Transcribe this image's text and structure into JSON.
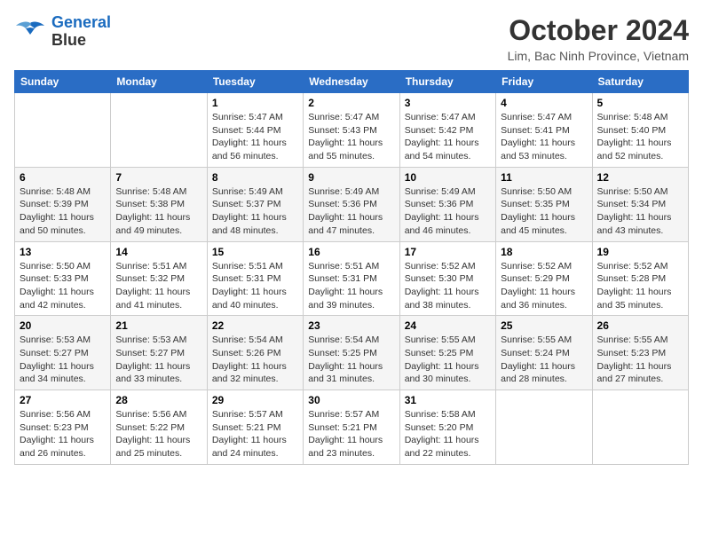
{
  "logo": {
    "line1": "General",
    "line2": "Blue"
  },
  "title": "October 2024",
  "location": "Lim, Bac Ninh Province, Vietnam",
  "weekdays": [
    "Sunday",
    "Monday",
    "Tuesday",
    "Wednesday",
    "Thursday",
    "Friday",
    "Saturday"
  ],
  "weeks": [
    [
      {
        "day": "",
        "info": ""
      },
      {
        "day": "",
        "info": ""
      },
      {
        "day": "1",
        "info": "Sunrise: 5:47 AM\nSunset: 5:44 PM\nDaylight: 11 hours and 56 minutes."
      },
      {
        "day": "2",
        "info": "Sunrise: 5:47 AM\nSunset: 5:43 PM\nDaylight: 11 hours and 55 minutes."
      },
      {
        "day": "3",
        "info": "Sunrise: 5:47 AM\nSunset: 5:42 PM\nDaylight: 11 hours and 54 minutes."
      },
      {
        "day": "4",
        "info": "Sunrise: 5:47 AM\nSunset: 5:41 PM\nDaylight: 11 hours and 53 minutes."
      },
      {
        "day": "5",
        "info": "Sunrise: 5:48 AM\nSunset: 5:40 PM\nDaylight: 11 hours and 52 minutes."
      }
    ],
    [
      {
        "day": "6",
        "info": "Sunrise: 5:48 AM\nSunset: 5:39 PM\nDaylight: 11 hours and 50 minutes."
      },
      {
        "day": "7",
        "info": "Sunrise: 5:48 AM\nSunset: 5:38 PM\nDaylight: 11 hours and 49 minutes."
      },
      {
        "day": "8",
        "info": "Sunrise: 5:49 AM\nSunset: 5:37 PM\nDaylight: 11 hours and 48 minutes."
      },
      {
        "day": "9",
        "info": "Sunrise: 5:49 AM\nSunset: 5:36 PM\nDaylight: 11 hours and 47 minutes."
      },
      {
        "day": "10",
        "info": "Sunrise: 5:49 AM\nSunset: 5:36 PM\nDaylight: 11 hours and 46 minutes."
      },
      {
        "day": "11",
        "info": "Sunrise: 5:50 AM\nSunset: 5:35 PM\nDaylight: 11 hours and 45 minutes."
      },
      {
        "day": "12",
        "info": "Sunrise: 5:50 AM\nSunset: 5:34 PM\nDaylight: 11 hours and 43 minutes."
      }
    ],
    [
      {
        "day": "13",
        "info": "Sunrise: 5:50 AM\nSunset: 5:33 PM\nDaylight: 11 hours and 42 minutes."
      },
      {
        "day": "14",
        "info": "Sunrise: 5:51 AM\nSunset: 5:32 PM\nDaylight: 11 hours and 41 minutes."
      },
      {
        "day": "15",
        "info": "Sunrise: 5:51 AM\nSunset: 5:31 PM\nDaylight: 11 hours and 40 minutes."
      },
      {
        "day": "16",
        "info": "Sunrise: 5:51 AM\nSunset: 5:31 PM\nDaylight: 11 hours and 39 minutes."
      },
      {
        "day": "17",
        "info": "Sunrise: 5:52 AM\nSunset: 5:30 PM\nDaylight: 11 hours and 38 minutes."
      },
      {
        "day": "18",
        "info": "Sunrise: 5:52 AM\nSunset: 5:29 PM\nDaylight: 11 hours and 36 minutes."
      },
      {
        "day": "19",
        "info": "Sunrise: 5:52 AM\nSunset: 5:28 PM\nDaylight: 11 hours and 35 minutes."
      }
    ],
    [
      {
        "day": "20",
        "info": "Sunrise: 5:53 AM\nSunset: 5:27 PM\nDaylight: 11 hours and 34 minutes."
      },
      {
        "day": "21",
        "info": "Sunrise: 5:53 AM\nSunset: 5:27 PM\nDaylight: 11 hours and 33 minutes."
      },
      {
        "day": "22",
        "info": "Sunrise: 5:54 AM\nSunset: 5:26 PM\nDaylight: 11 hours and 32 minutes."
      },
      {
        "day": "23",
        "info": "Sunrise: 5:54 AM\nSunset: 5:25 PM\nDaylight: 11 hours and 31 minutes."
      },
      {
        "day": "24",
        "info": "Sunrise: 5:55 AM\nSunset: 5:25 PM\nDaylight: 11 hours and 30 minutes."
      },
      {
        "day": "25",
        "info": "Sunrise: 5:55 AM\nSunset: 5:24 PM\nDaylight: 11 hours and 28 minutes."
      },
      {
        "day": "26",
        "info": "Sunrise: 5:55 AM\nSunset: 5:23 PM\nDaylight: 11 hours and 27 minutes."
      }
    ],
    [
      {
        "day": "27",
        "info": "Sunrise: 5:56 AM\nSunset: 5:23 PM\nDaylight: 11 hours and 26 minutes."
      },
      {
        "day": "28",
        "info": "Sunrise: 5:56 AM\nSunset: 5:22 PM\nDaylight: 11 hours and 25 minutes."
      },
      {
        "day": "29",
        "info": "Sunrise: 5:57 AM\nSunset: 5:21 PM\nDaylight: 11 hours and 24 minutes."
      },
      {
        "day": "30",
        "info": "Sunrise: 5:57 AM\nSunset: 5:21 PM\nDaylight: 11 hours and 23 minutes."
      },
      {
        "day": "31",
        "info": "Sunrise: 5:58 AM\nSunset: 5:20 PM\nDaylight: 11 hours and 22 minutes."
      },
      {
        "day": "",
        "info": ""
      },
      {
        "day": "",
        "info": ""
      }
    ]
  ]
}
